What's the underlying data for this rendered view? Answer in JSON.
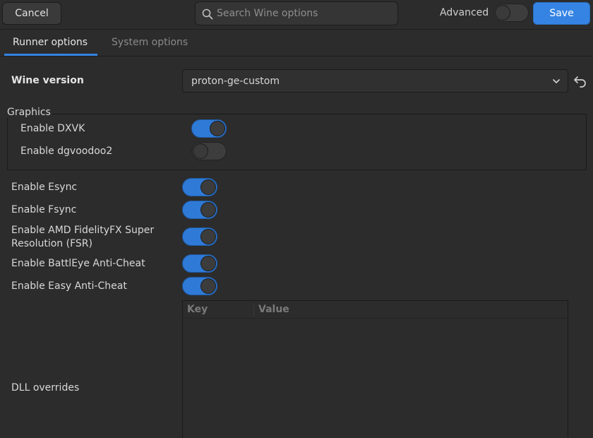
{
  "header": {
    "cancel_label": "Cancel",
    "search_placeholder": "Search Wine options",
    "advanced_label": "Advanced",
    "advanced_enabled": false,
    "save_label": "Save"
  },
  "tabs": [
    {
      "label": "Runner options",
      "active": true
    },
    {
      "label": "System options",
      "active": false
    }
  ],
  "wine_version": {
    "label": "Wine version",
    "value": "proton-ge-custom"
  },
  "graphics": {
    "legend": "Graphics",
    "options": [
      {
        "label": "Enable DXVK",
        "enabled": true
      },
      {
        "label": "Enable dgvoodoo2",
        "enabled": false
      }
    ]
  },
  "options": [
    {
      "label": "Enable Esync",
      "enabled": true
    },
    {
      "label": "Enable Fsync",
      "enabled": true
    },
    {
      "label_line1": "Enable AMD FidelityFX Super",
      "label_line2": "Resolution (FSR)",
      "enabled": true
    },
    {
      "label": "Enable BattlEye Anti-Cheat",
      "enabled": true
    },
    {
      "label": "Enable Easy Anti-Cheat",
      "enabled": true
    }
  ],
  "dll_overrides": {
    "label": "DLL overrides",
    "columns": [
      "Key",
      "Value"
    ],
    "rows": []
  },
  "colors": {
    "accent": "#3584e4",
    "switch_on": "#2f7ad6",
    "background": "#2c2c2c"
  },
  "icons": {
    "search": "search-icon",
    "chevron": "chevron-down-icon",
    "reset": "undo-icon"
  }
}
